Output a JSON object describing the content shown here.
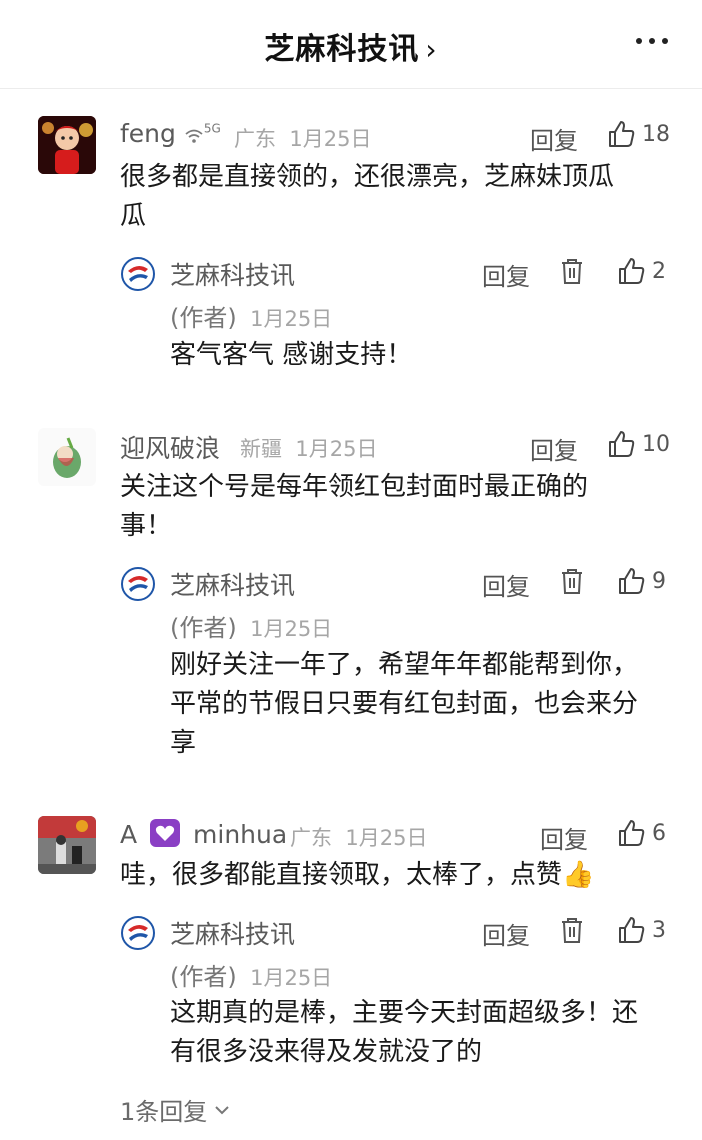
{
  "header": {
    "title": "芝麻科技讯",
    "chevron": "›"
  },
  "comments": [
    {
      "name": "feng",
      "badge": "5G",
      "location": "广东",
      "date": "1月25日",
      "text_lines": [
        "很多都是直接领的，还很漂亮，芝麻妹顶瓜",
        "瓜"
      ],
      "reply_label": "回复",
      "likes": "18",
      "author_reply": {
        "name": "芝麻科技讯",
        "author_tag": "(作者)",
        "date": "1月25日",
        "text_lines": [
          "客气客气 感谢支持！"
        ],
        "reply_label": "回复",
        "likes": "2"
      }
    },
    {
      "name": "迎风破浪",
      "location": "新疆",
      "date": "1月25日",
      "text_lines": [
        "关注这个号是每年领红包封面时最正确的",
        "事！"
      ],
      "reply_label": "回复",
      "likes": "10",
      "author_reply": {
        "name": "芝麻科技讯",
        "author_tag": "(作者)",
        "date": "1月25日",
        "text_lines": [
          "刚好关注一年了，希望年年都能帮到你，",
          "平常的节假日只要有红包封面，也会来分",
          "享"
        ],
        "reply_label": "回复",
        "likes": "9"
      }
    },
    {
      "name_prefix": "A",
      "name": "minhua",
      "location": "广东",
      "date": "1月25日",
      "text_lines": [
        "哇，很多都能直接领取，太棒了，点赞👍"
      ],
      "reply_label": "回复",
      "likes": "6",
      "author_reply": {
        "name": "芝麻科技讯",
        "author_tag": "(作者)",
        "date": "1月25日",
        "text_lines": [
          "这期真的是棒，主要今天封面超级多！还",
          "有很多没来得及发就没了的"
        ],
        "reply_label": "回复",
        "likes": "3"
      }
    }
  ],
  "more_replies": "1条回复",
  "colors": {
    "brand_red": "#d62a2a",
    "brand_blue": "#1f56a8",
    "heart_purple": "#8a3fc4"
  }
}
